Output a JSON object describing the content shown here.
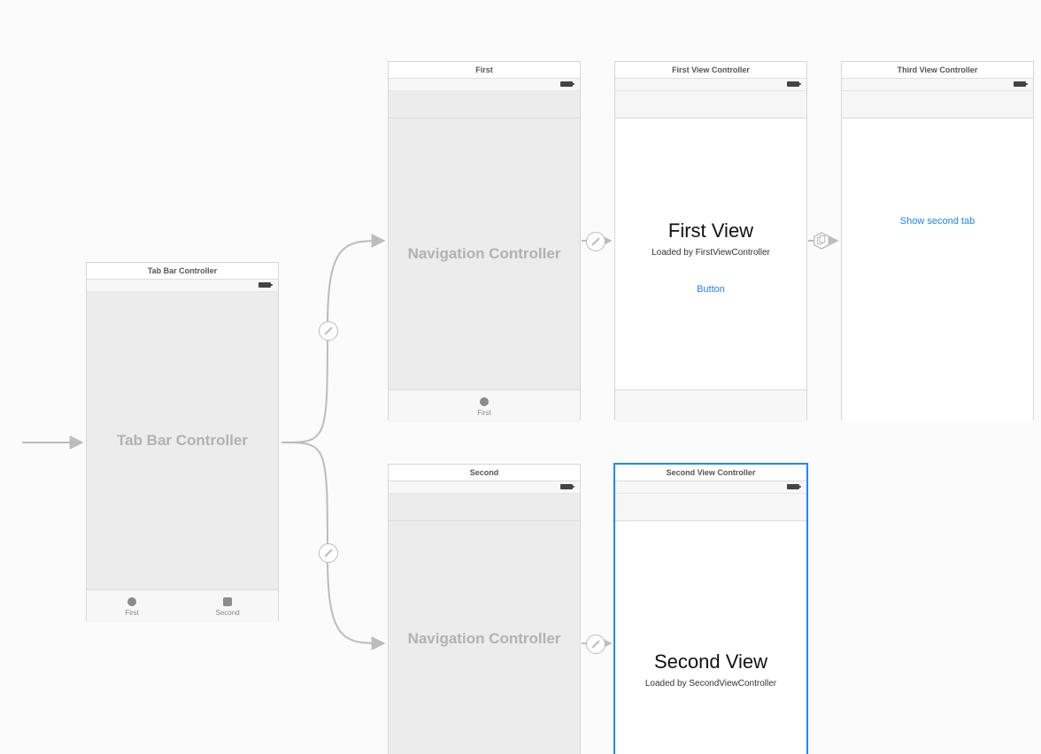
{
  "tabbar": {
    "title": "Tab Bar Controller",
    "placeholder": "Tab Bar Controller",
    "items": [
      {
        "label": "First"
      },
      {
        "label": "Second"
      }
    ]
  },
  "nav1": {
    "title": "First",
    "placeholder": "Navigation Controller",
    "tab_label": "First"
  },
  "nav2": {
    "title": "Second",
    "placeholder": "Navigation Controller"
  },
  "first_vc": {
    "title": "First View Controller",
    "heading": "First View",
    "subtitle": "Loaded by FirstViewController",
    "button_label": "Button"
  },
  "second_vc": {
    "title": "Second View Controller",
    "heading": "Second View",
    "subtitle": "Loaded by SecondViewController"
  },
  "third_vc": {
    "title": "Third View Controller",
    "button_label": "Show second tab"
  }
}
